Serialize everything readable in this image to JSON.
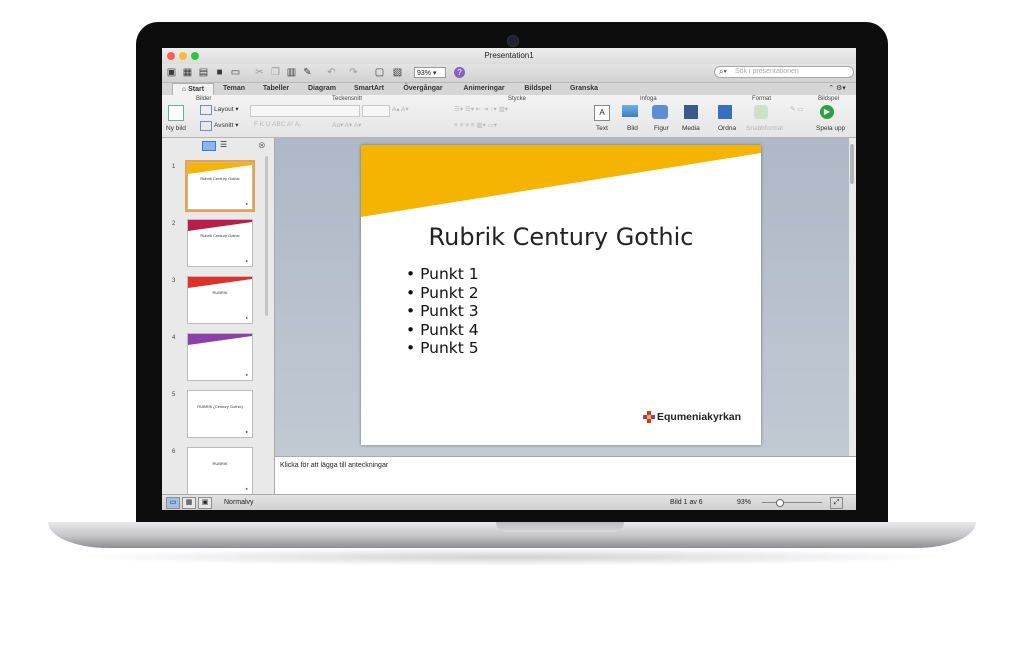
{
  "window": {
    "title": "Presentation1"
  },
  "toolbar": {
    "zoom": "93%",
    "search_placeholder": "Sök i presentationen"
  },
  "tabs": [
    "Start",
    "Teman",
    "Tabeller",
    "Diagram",
    "SmartArt",
    "Övergångar",
    "Animeringar",
    "Bildspel",
    "Granska"
  ],
  "ribbon": {
    "groups": {
      "bilder": "Bilder",
      "teckensnitt": "Teckensnitt",
      "stycke": "Stycke",
      "infoga": "Infoga",
      "format": "Format",
      "bildspel": "Bildspel"
    },
    "new_slide": "Ny bild",
    "layout": "Layout",
    "section": "Avsnitt",
    "text": "Text",
    "picture": "Bild",
    "shape": "Figur",
    "media": "Media",
    "arrange": "Ordna",
    "quick_styles": "Snabbformat",
    "play": "Spela upp",
    "font_buttons": "F  K  U  ABC  A²  A₂"
  },
  "thumbnails": [
    {
      "num": "1",
      "title": "Rubrik Century Gothic",
      "accent": "#f5b400",
      "selected": true
    },
    {
      "num": "2",
      "title": "Rubrik Century Gothic",
      "accent": "#b81e4a",
      "selected": false
    },
    {
      "num": "3",
      "title": "RUBRIK",
      "accent": "#e0302a",
      "selected": false
    },
    {
      "num": "4",
      "title": "",
      "accent": "#8b3fa8",
      "selected": false
    },
    {
      "num": "5",
      "title": "RUBRIK (Century Gothic)",
      "accent": "",
      "selected": false
    },
    {
      "num": "6",
      "title": "RUBRIK",
      "accent": "",
      "selected": false
    }
  ],
  "slide": {
    "title": "Rubrik Century Gothic",
    "bullets": [
      "Punkt 1",
      "Punkt 2",
      "Punkt 3",
      "Punkt 4",
      "Punkt 5"
    ],
    "logo_text": "Equmeniakyrkan",
    "accent": "#f5b400"
  },
  "notes": {
    "placeholder": "Klicka för att lägga till anteckningar"
  },
  "status": {
    "view": "Normalvy",
    "slide_count": "Bild 1 av 6",
    "zoom": "93%"
  }
}
